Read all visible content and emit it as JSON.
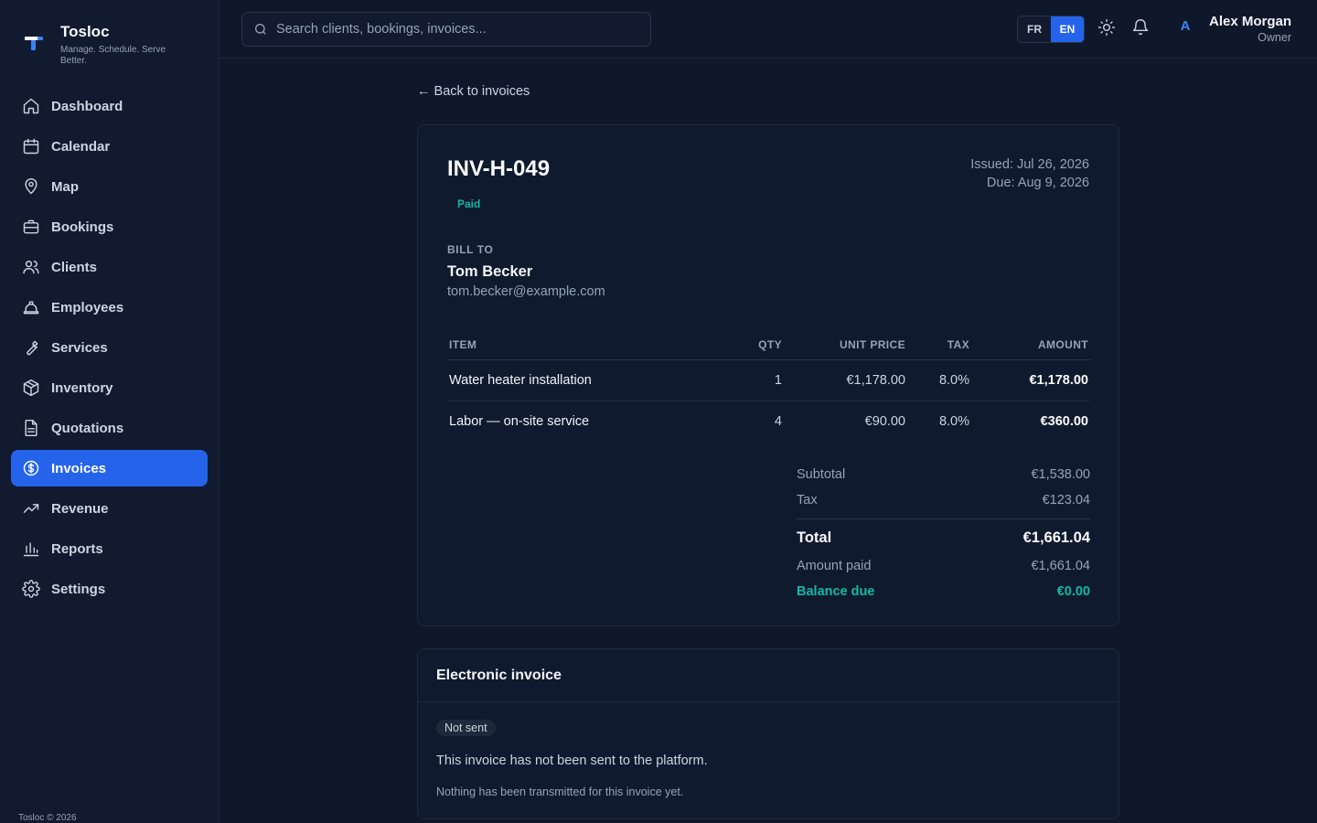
{
  "brand": {
    "name": "Tosloc",
    "tagline": "Manage. Schedule. Serve Better."
  },
  "nav": [
    {
      "label": "Dashboard",
      "icon": "home-icon"
    },
    {
      "label": "Calendar",
      "icon": "calendar-icon"
    },
    {
      "label": "Map",
      "icon": "map-pin-icon"
    },
    {
      "label": "Bookings",
      "icon": "briefcase-icon"
    },
    {
      "label": "Clients",
      "icon": "users-icon"
    },
    {
      "label": "Employees",
      "icon": "hard-hat-icon"
    },
    {
      "label": "Services",
      "icon": "wrench-icon"
    },
    {
      "label": "Inventory",
      "icon": "package-icon"
    },
    {
      "label": "Quotations",
      "icon": "file-text-icon"
    },
    {
      "label": "Invoices",
      "icon": "dollar-circle-icon"
    },
    {
      "label": "Revenue",
      "icon": "trending-up-icon"
    },
    {
      "label": "Reports",
      "icon": "bar-chart-icon"
    },
    {
      "label": "Settings",
      "icon": "gear-icon"
    }
  ],
  "active_nav": "Invoices",
  "footer": "Tosloc © 2026",
  "search": {
    "placeholder": "Search clients, bookings, invoices..."
  },
  "lang": {
    "fr": "FR",
    "en": "EN",
    "selected": "EN"
  },
  "user": {
    "initial": "A",
    "name": "Alex Morgan",
    "role": "Owner"
  },
  "back_link": "← Back to invoices",
  "invoice": {
    "number": "INV-H-049",
    "status": "Paid",
    "issued": "Issued: Jul 26, 2026",
    "due": "Due: Aug 9, 2026",
    "bill_to_label": "BILL TO",
    "client_name": "Tom Becker",
    "client_email": "tom.becker@example.com",
    "columns": [
      "ITEM",
      "QTY",
      "UNIT PRICE",
      "TAX",
      "AMOUNT"
    ],
    "items": [
      {
        "item": "Water heater installation",
        "qty": "1",
        "unit_price": "€1,178.00",
        "tax": "8.0%",
        "amount": "€1,178.00"
      },
      {
        "item": "Labor — on-site service",
        "qty": "4",
        "unit_price": "€90.00",
        "tax": "8.0%",
        "amount": "€360.00"
      }
    ],
    "totals": {
      "subtotal_label": "Subtotal",
      "subtotal": "€1,538.00",
      "tax_label": "Tax",
      "tax": "€123.04",
      "total_label": "Total",
      "total": "€1,661.04",
      "paid_label": "Amount paid",
      "paid": "€1,661.04",
      "balance_label": "Balance due",
      "balance": "€0.00"
    }
  },
  "einvoice": {
    "title": "Electronic invoice",
    "status": "Not sent",
    "message": "This invoice has not been sent to the platform.",
    "note": "Nothing has been transmitted for this invoice yet."
  },
  "colors": {
    "accent": "#2563eb",
    "success": "#14b8a6",
    "background": "#0f172a"
  }
}
